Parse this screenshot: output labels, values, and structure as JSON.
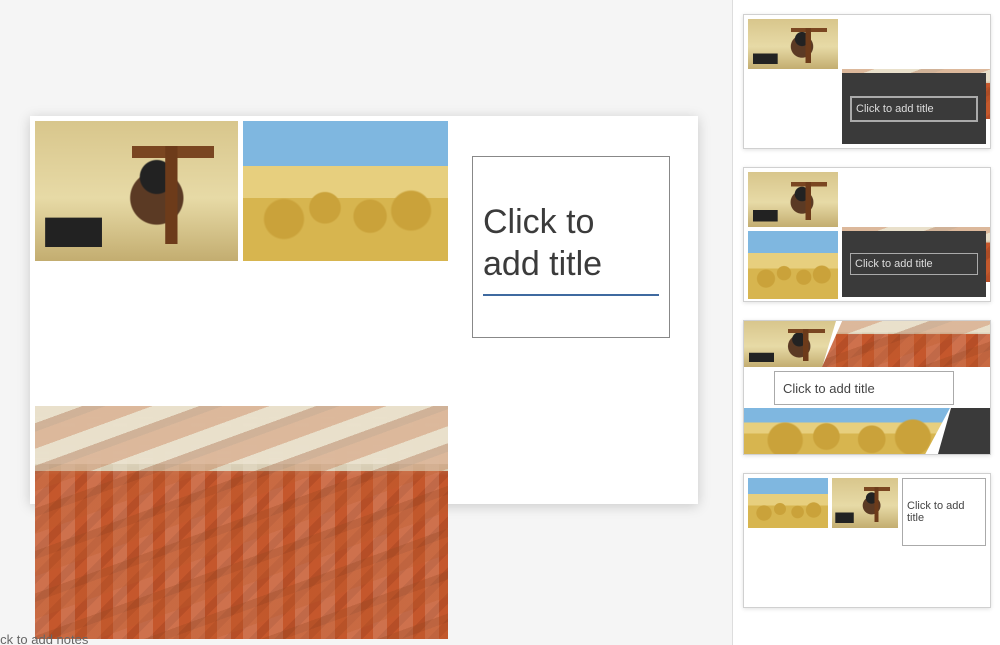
{
  "main_slide": {
    "title_placeholder": "Click to add title"
  },
  "notes": {
    "placeholder": "Click to add notes"
  },
  "panel": {
    "thumbs": [
      {
        "title_placeholder": "Click to add title"
      },
      {
        "title_placeholder": "Click to add title"
      },
      {
        "title_placeholder": "Click to add title"
      },
      {
        "title_placeholder": "Click to add title"
      }
    ]
  },
  "images": {
    "chimp": "chimp-painting",
    "wheat": "wheat-field-painting",
    "city": "cityscape-photo"
  }
}
